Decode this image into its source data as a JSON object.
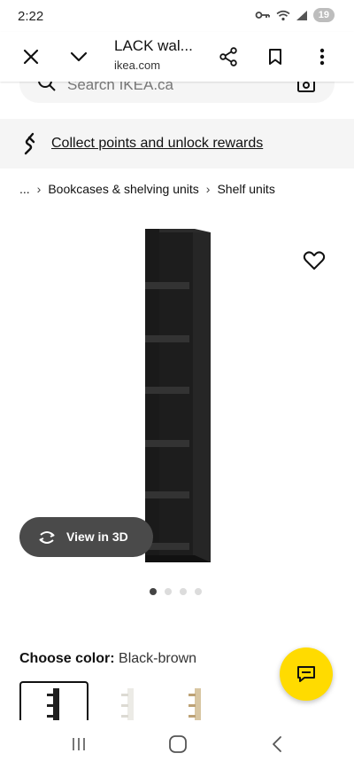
{
  "status_bar": {
    "time": "2:22",
    "battery": "19",
    "icons": [
      "vpn-key-icon",
      "wifi-icon",
      "signal-icon",
      "battery-icon"
    ]
  },
  "browser": {
    "title": "LACK wal...",
    "url": "ikea.com",
    "icons": [
      "close-icon",
      "chevron-down-icon",
      "share-icon",
      "bookmark-icon",
      "more-vert-icon"
    ]
  },
  "search": {
    "placeholder": "Search IKEA.ca"
  },
  "rewards": {
    "text": "Collect points and unlock rewards",
    "icon": "rewards-icon"
  },
  "breadcrumb": {
    "ellipsis": "...",
    "items": [
      "Bookcases & shelving units",
      "Shelf units"
    ]
  },
  "product": {
    "view_3d_label": "View in 3D",
    "carousel_total": 4,
    "carousel_active": 1,
    "shelf_color": "#1f1f1f"
  },
  "color": {
    "label": "Choose color:",
    "value": "Black-brown",
    "swatch_colors": [
      "#1f1f1f",
      "#f2f0ea",
      "#c9b493"
    ]
  },
  "accent": {
    "fab_color": "#ffdb00"
  },
  "navbar": {
    "icons": [
      "recent-apps-icon",
      "home-icon",
      "back-icon"
    ]
  }
}
